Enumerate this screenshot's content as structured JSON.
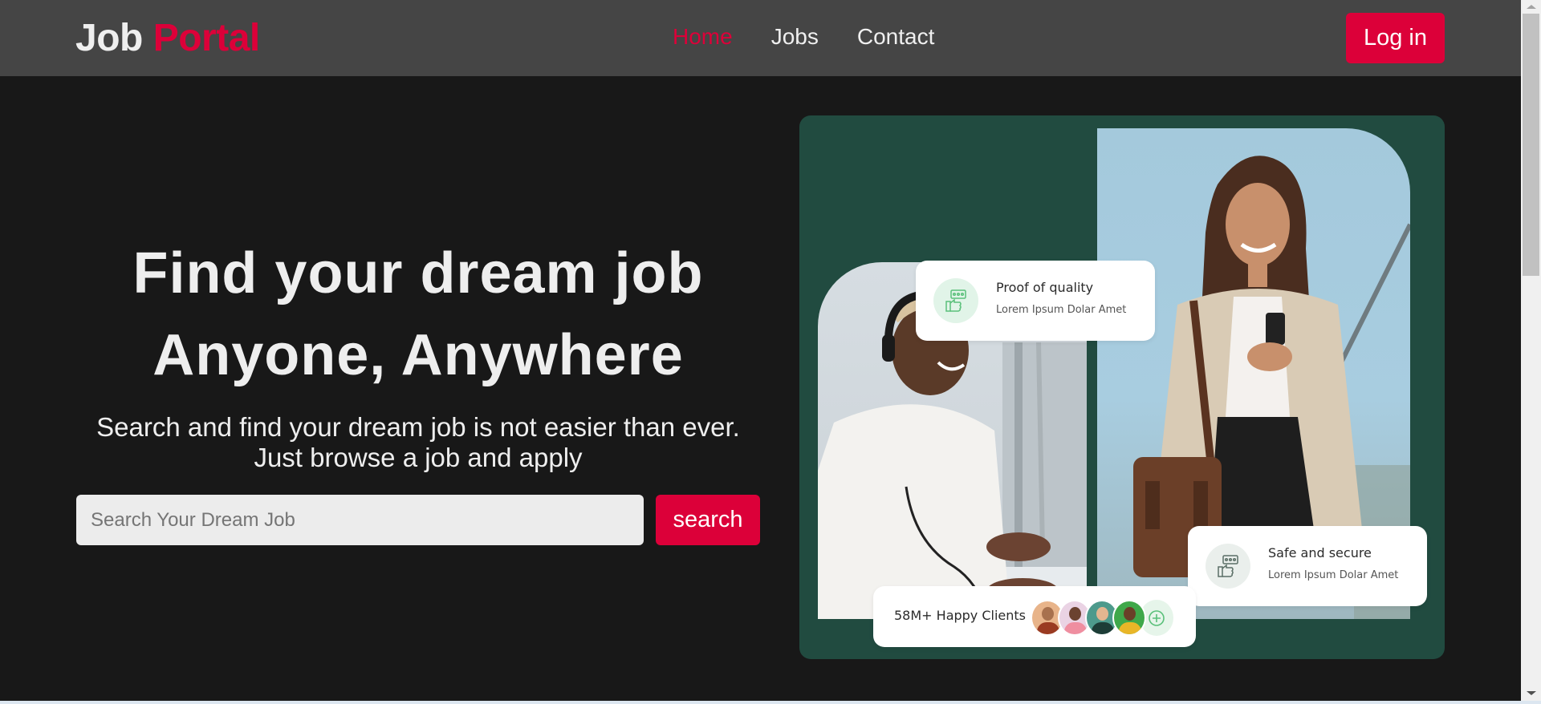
{
  "brand": {
    "part1": "Job",
    "part2": "Portal",
    "accent_color": "#dc0039"
  },
  "nav": {
    "links": [
      {
        "label": "Home",
        "active": true
      },
      {
        "label": "Jobs",
        "active": false
      },
      {
        "label": "Contact",
        "active": false
      }
    ],
    "login_label": "Log in"
  },
  "hero": {
    "title_line1": "Find your dream job",
    "title_line2": "Anyone, Anywhere",
    "subtitle_line1": "Search and find your dream job is not easier than ever.",
    "subtitle_line2": "Just browse a job and apply",
    "search": {
      "placeholder": "Search Your Dream Job",
      "value": "",
      "button_label": "search"
    }
  },
  "showcase": {
    "panel_color": "#214b40",
    "cards": [
      {
        "title": "Proof of quality",
        "description": "Lorem Ipsum Dolar Amet",
        "icon": "thumbs-up-review-icon"
      },
      {
        "title": "Safe and secure",
        "description": "Lorem Ipsum Dolar Amet",
        "icon": "thumbs-up-review-icon"
      }
    ],
    "clients": {
      "label": "58M+ Happy Clients",
      "avatar_count": 4,
      "add_icon": "plus-circle-icon"
    }
  }
}
